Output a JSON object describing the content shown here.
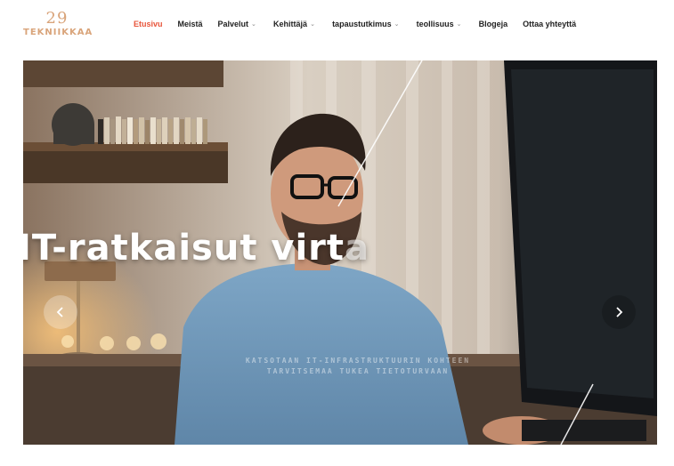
{
  "logo": {
    "number": "29",
    "word": "TEKNIIKKAA"
  },
  "nav": {
    "items": [
      {
        "label": "Etusivu",
        "active": true,
        "dropdown": false
      },
      {
        "label": "Meistä",
        "active": false,
        "dropdown": false
      },
      {
        "label": "Palvelut",
        "active": false,
        "dropdown": true
      },
      {
        "label": "Kehittäjä",
        "active": false,
        "dropdown": true
      },
      {
        "label": "tapaustutkimus",
        "active": false,
        "dropdown": true
      },
      {
        "label": "teollisuus",
        "active": false,
        "dropdown": true
      },
      {
        "label": "Blogeja",
        "active": false,
        "dropdown": false
      },
      {
        "label": "Ottaa yhteyttä",
        "active": false,
        "dropdown": false
      }
    ]
  },
  "hero": {
    "title_main": "IT-ratkaisut virt",
    "title_fade": "a",
    "subtitle_line1": "KATSOTAAN IT-INFRASTRUKTUURIN KOHTEEN",
    "subtitle_line2": "TARVITSEMAA TUKEA TIETOTURVAAN"
  },
  "slider": {
    "prev_icon": "chevron-left-icon",
    "next_icon": "chevron-right-icon"
  },
  "colors": {
    "accent": "#e8543a",
    "logo": "#d9a47a",
    "text": "#222222"
  }
}
